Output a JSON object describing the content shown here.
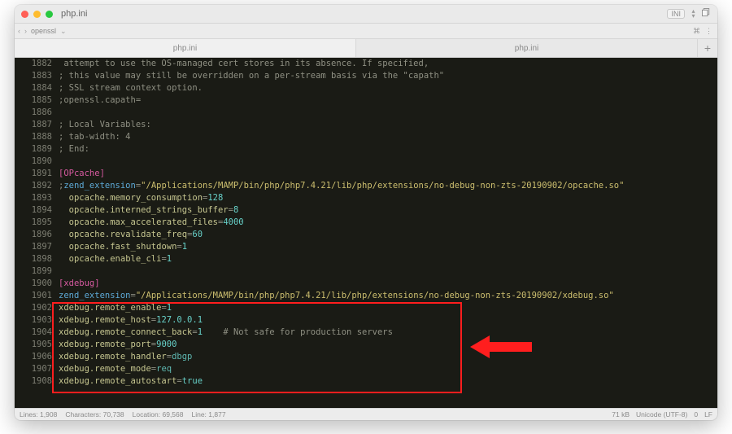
{
  "window": {
    "title": "php.ini",
    "language_badge": "INI"
  },
  "toolbar": {
    "crumb1": "openssl",
    "right1": "⌘",
    "right2": "⋮"
  },
  "tabs": [
    {
      "label": "php.ini",
      "active": true
    },
    {
      "label": "php.ini",
      "active": false
    }
  ],
  "statusbar": {
    "lines": "Lines: 1,908",
    "chars": "Characters: 70,738",
    "loc": "Location: 69,568",
    "line": "Line: 1,877",
    "size": "71 kB",
    "enc": "Unicode (UTF-8)",
    "tabsz": "0",
    "eol": "LF"
  },
  "code": {
    "lines": [
      {
        "n": 1882,
        "segs": [
          [
            " attempt to use the OS-managed cert stores in its absence. If specified,",
            "c-grey"
          ]
        ]
      },
      {
        "n": 1883,
        "segs": [
          [
            "; this value may still be overridden on a per-stream basis via the \"capath\"",
            "c-grey"
          ]
        ]
      },
      {
        "n": 1884,
        "segs": [
          [
            "; SSL stream context option.",
            "c-grey"
          ]
        ]
      },
      {
        "n": 1885,
        "segs": [
          [
            ";openssl.capath=",
            "c-grey"
          ]
        ]
      },
      {
        "n": 1886,
        "segs": []
      },
      {
        "n": 1887,
        "segs": [
          [
            "; Local Variables:",
            "c-grey"
          ]
        ]
      },
      {
        "n": 1888,
        "segs": [
          [
            "; tab-width: 4",
            "c-grey"
          ]
        ]
      },
      {
        "n": 1889,
        "segs": [
          [
            "; End:",
            "c-grey"
          ]
        ]
      },
      {
        "n": 1890,
        "segs": []
      },
      {
        "n": 1891,
        "segs": [
          [
            "[OPcache]",
            "c-mag"
          ]
        ]
      },
      {
        "n": 1892,
        "segs": [
          [
            ";",
            "c-grey"
          ],
          [
            "zend_extension",
            "c-blue"
          ],
          [
            "=",
            "c-grey"
          ],
          [
            "\"",
            "c-str"
          ],
          [
            "/Applications/MAMP/bin/php/php7.4.21/lib/php/extensions/no-debug-non-zts-20190902/opcache.so",
            "c-str"
          ],
          [
            "\"",
            "c-str"
          ]
        ]
      },
      {
        "n": 1893,
        "segs": [
          [
            "  ",
            "code"
          ],
          [
            "opcache.memory_consumption",
            "c-optkey"
          ],
          [
            "=",
            "c-grey"
          ],
          [
            "128",
            "c-cyan"
          ]
        ]
      },
      {
        "n": 1894,
        "segs": [
          [
            "  ",
            "code"
          ],
          [
            "opcache.interned_strings_buffer",
            "c-optkey"
          ],
          [
            "=",
            "c-grey"
          ],
          [
            "8",
            "c-cyan"
          ]
        ]
      },
      {
        "n": 1895,
        "segs": [
          [
            "  ",
            "code"
          ],
          [
            "opcache.max_accelerated_files",
            "c-optkey"
          ],
          [
            "=",
            "c-grey"
          ],
          [
            "4000",
            "c-cyan"
          ]
        ]
      },
      {
        "n": 1896,
        "segs": [
          [
            "  ",
            "code"
          ],
          [
            "opcache.revalidate_freq",
            "c-optkey"
          ],
          [
            "=",
            "c-grey"
          ],
          [
            "60",
            "c-cyan"
          ]
        ]
      },
      {
        "n": 1897,
        "segs": [
          [
            "  ",
            "code"
          ],
          [
            "opcache.fast_shutdown",
            "c-optkey"
          ],
          [
            "=",
            "c-grey"
          ],
          [
            "1",
            "c-cyan"
          ]
        ]
      },
      {
        "n": 1898,
        "segs": [
          [
            "  ",
            "code"
          ],
          [
            "opcache.enable_cli",
            "c-optkey"
          ],
          [
            "=",
            "c-grey"
          ],
          [
            "1",
            "c-cyan"
          ]
        ]
      },
      {
        "n": 1899,
        "segs": []
      },
      {
        "n": 1900,
        "segs": [
          [
            "[xdebug]",
            "c-mag"
          ]
        ]
      },
      {
        "n": 1901,
        "segs": [
          [
            "zend_extension",
            "c-blue"
          ],
          [
            "=",
            "c-grey"
          ],
          [
            "\"",
            "c-str"
          ],
          [
            "/Applications/MAMP/bin/php/php7.4.21/lib/php/extensions/no-debug-non-zts-20190902/xdebug.so",
            "c-str"
          ],
          [
            "\"",
            "c-str"
          ]
        ]
      },
      {
        "n": 1902,
        "segs": [
          [
            "xdebug.remote_enable",
            "c-optkey"
          ],
          [
            "=",
            "c-grey"
          ],
          [
            "1",
            "c-cyan"
          ]
        ]
      },
      {
        "n": 1903,
        "segs": [
          [
            "xdebug.remote_host",
            "c-optkey"
          ],
          [
            "=",
            "c-grey"
          ],
          [
            "127.0.0.1",
            "c-cyan"
          ]
        ]
      },
      {
        "n": 1904,
        "segs": [
          [
            "xdebug.remote_connect_back",
            "c-optkey"
          ],
          [
            "=",
            "c-grey"
          ],
          [
            "1",
            "c-cyan"
          ],
          [
            "    ",
            "code"
          ],
          [
            "# Not safe for production servers",
            "c-grey"
          ]
        ]
      },
      {
        "n": 1905,
        "segs": [
          [
            "xdebug.remote_port",
            "c-optkey"
          ],
          [
            "=",
            "c-grey"
          ],
          [
            "9000",
            "c-cyan"
          ]
        ]
      },
      {
        "n": 1906,
        "segs": [
          [
            "xdebug.remote_handler",
            "c-optkey"
          ],
          [
            "=",
            "c-grey"
          ],
          [
            "dbgp",
            "c-cyan2"
          ]
        ]
      },
      {
        "n": 1907,
        "segs": [
          [
            "xdebug.remote_mode",
            "c-optkey"
          ],
          [
            "=",
            "c-grey"
          ],
          [
            "req",
            "c-cyan2"
          ]
        ]
      },
      {
        "n": 1908,
        "segs": [
          [
            "xdebug.remote_autostart",
            "c-optkey"
          ],
          [
            "=",
            "c-grey"
          ],
          [
            "true",
            "c-cyan"
          ]
        ]
      }
    ]
  }
}
